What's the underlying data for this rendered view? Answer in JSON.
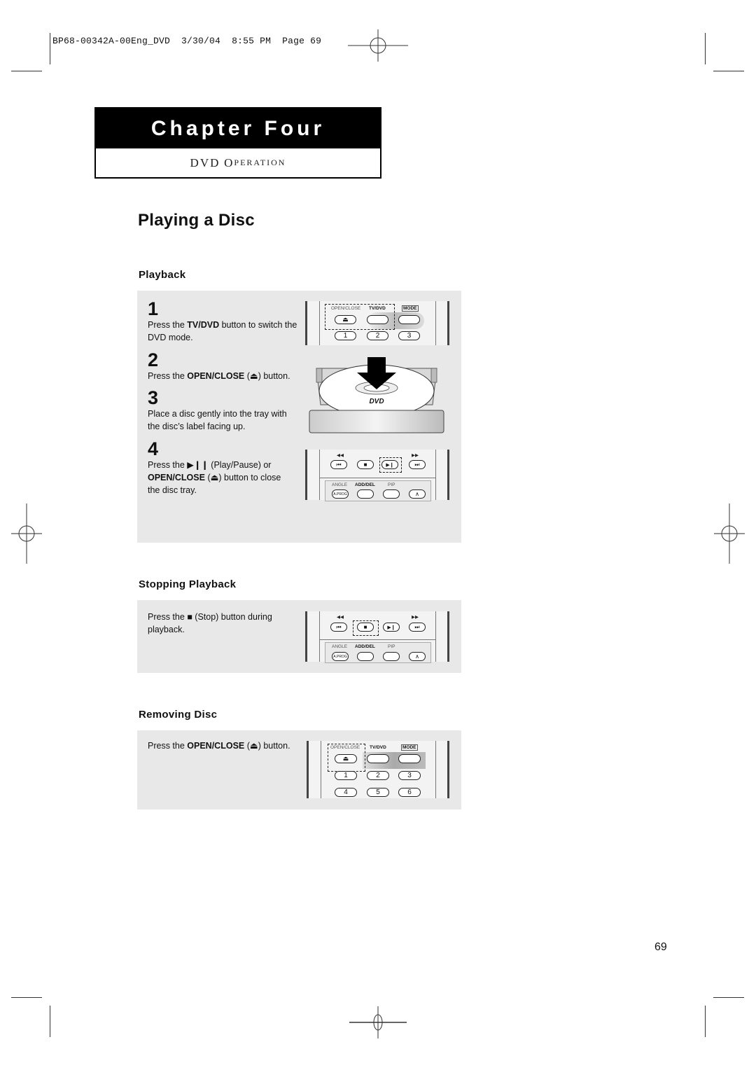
{
  "print_slug": {
    "file": "BP68-00342A-00Eng_DVD",
    "date": "3/30/04",
    "time": "8:55 PM",
    "page_label": "Page",
    "page_value": "69"
  },
  "chapter": {
    "title": "Chapter Four",
    "subtitle_initial_1": "DVD",
    "subtitle_O": "O",
    "subtitle_rest": "PERATION"
  },
  "page_title": "Playing a Disc",
  "sections": {
    "playback": {
      "title": "Playback",
      "steps": [
        {
          "number": "1",
          "pre": "Press the ",
          "bold": "TV/DVD",
          "post": " button to switch the DVD mode."
        },
        {
          "number": "2",
          "pre": "Press the ",
          "bold": "OPEN/CLOSE",
          "post": " (⏏) button."
        },
        {
          "number": "3",
          "pre": "Place a disc gently into the tray with the disc’s label facing up.",
          "bold": "",
          "post": ""
        },
        {
          "number": "4",
          "pre": "Press the ▶❙❙ (Play/Pause) or ",
          "bold": "OPEN/CLOSE",
          "post": " (⏏) button to close the disc tray."
        }
      ]
    },
    "stopping": {
      "title": "Stopping Playback",
      "text": "Press the ■ (Stop) button during playback."
    },
    "removing": {
      "title": "Removing Disc",
      "pre": "Press the ",
      "bold": "OPEN/CLOSE",
      "post": " (⏏) button."
    }
  },
  "remote": {
    "open_close": "OPEN/CLOSE",
    "tv_dvd": "TV/DVD",
    "mode": "MODE",
    "angle": "ANGLE",
    "add_del": "ADD/DEL",
    "pip": "PIP",
    "a_prog": "A.PROG",
    "eject_glyph": "⏏",
    "prev_glyph": "⏮",
    "stop_glyph": "■",
    "play_pause_glyph": "▶❙",
    "next_glyph": "⏭",
    "rew_glyph": "◀◀",
    "ff_glyph": "▶▶",
    "up_glyph": "∧",
    "digits": [
      "1",
      "2",
      "3",
      "4",
      "5",
      "6"
    ],
    "dvd_logo": "DVD"
  },
  "page_number": "69"
}
